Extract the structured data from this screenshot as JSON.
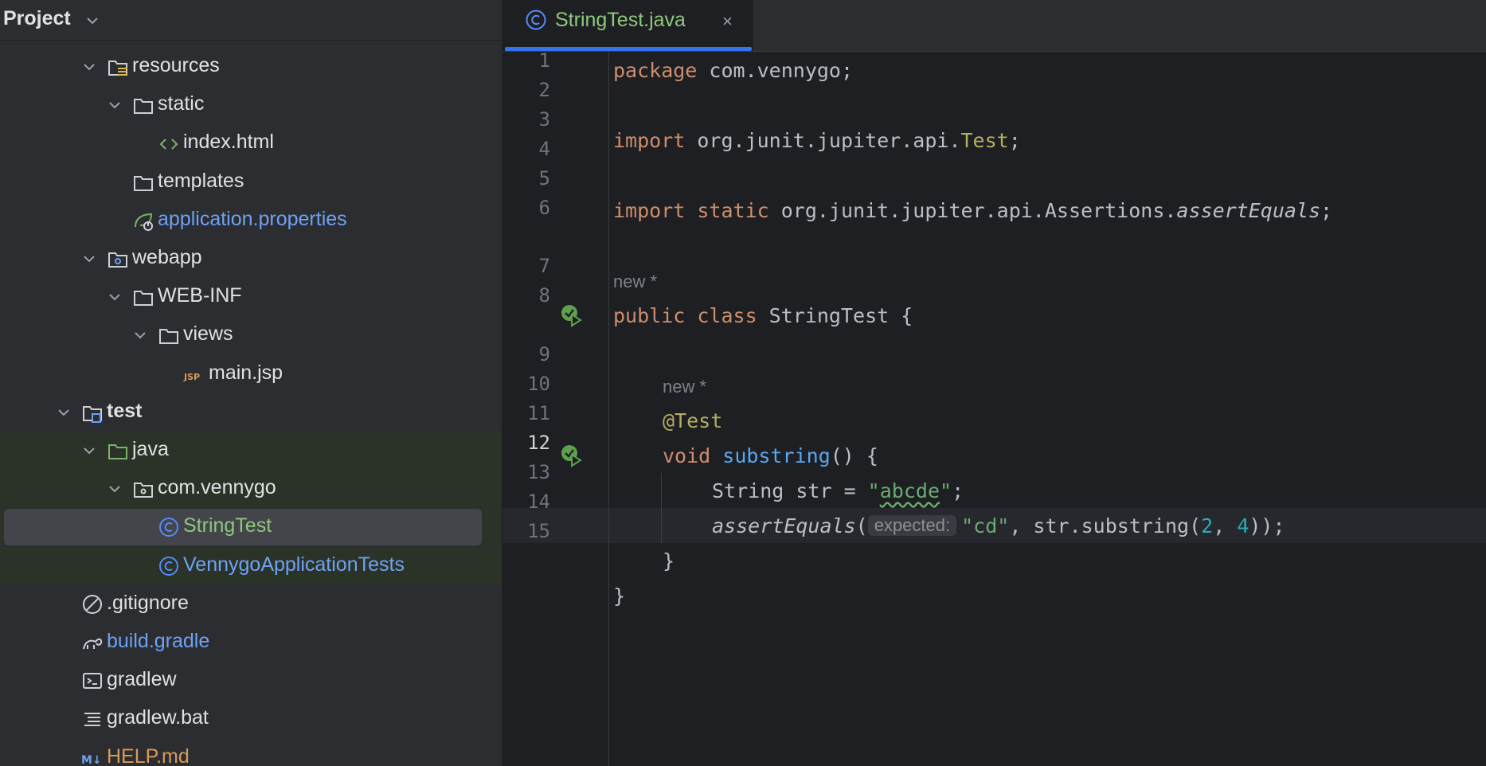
{
  "project": {
    "title": "Project",
    "tree": [
      {
        "label": "resources",
        "icon": "resources-folder-icon",
        "level": 3,
        "expanded": true,
        "color": "default"
      },
      {
        "label": "static",
        "icon": "folder-icon",
        "level": 4,
        "expanded": true,
        "color": "default"
      },
      {
        "label": "index.html",
        "icon": "html-file-icon",
        "level": 5,
        "color": "default"
      },
      {
        "label": "templates",
        "icon": "folder-icon",
        "level": 4,
        "color": "default"
      },
      {
        "label": "application.properties",
        "icon": "spring-properties-icon",
        "level": 4,
        "color": "blue"
      },
      {
        "label": "webapp",
        "icon": "web-folder-icon",
        "level": 3,
        "expanded": true,
        "color": "default"
      },
      {
        "label": "WEB-INF",
        "icon": "folder-icon",
        "level": 4,
        "expanded": true,
        "color": "default"
      },
      {
        "label": "views",
        "icon": "folder-icon",
        "level": 5,
        "expanded": true,
        "color": "default"
      },
      {
        "label": "main.jsp",
        "icon": "jsp-file-icon",
        "level": 6,
        "color": "default"
      },
      {
        "label": "test",
        "icon": "test-module-folder-icon",
        "level": 2,
        "expanded": true,
        "color": "default",
        "bold": true
      },
      {
        "label": "java",
        "icon": "test-source-folder-icon",
        "level": 3,
        "expanded": true,
        "color": "default",
        "green_bg": true
      },
      {
        "label": "com.vennygo",
        "icon": "package-icon",
        "level": 4,
        "expanded": true,
        "color": "default",
        "green_bg": true
      },
      {
        "label": "StringTest",
        "icon": "java-class-icon",
        "level": 5,
        "color": "green",
        "green_bg": true,
        "selected": true
      },
      {
        "label": "VennygoApplicationTests",
        "icon": "java-class-icon",
        "level": 5,
        "color": "blue",
        "green_bg": true
      },
      {
        "label": ".gitignore",
        "icon": "ignore-file-icon",
        "level": 2,
        "color": "default"
      },
      {
        "label": "build.gradle",
        "icon": "gradle-icon",
        "level": 2,
        "color": "blue"
      },
      {
        "label": "gradlew",
        "icon": "terminal-file-icon",
        "level": 2,
        "color": "default"
      },
      {
        "label": "gradlew.bat",
        "icon": "text-file-icon",
        "level": 2,
        "color": "default"
      },
      {
        "label": "HELP.md",
        "icon": "markdown-icon",
        "level": 2,
        "color": "orange"
      }
    ]
  },
  "editor": {
    "tab": {
      "label": "StringTest.java",
      "close": "×"
    },
    "current_line": 12,
    "new_marker": "new *",
    "param_hint": "expected:",
    "lines": [
      {
        "n": "1"
      },
      {
        "n": "2"
      },
      {
        "n": "3"
      },
      {
        "n": "4"
      },
      {
        "n": "5"
      },
      {
        "n": "6"
      },
      {
        "n": "7"
      },
      {
        "n": "8"
      },
      {
        "n": "9"
      },
      {
        "n": "10"
      },
      {
        "n": "11"
      },
      {
        "n": "12"
      },
      {
        "n": "13"
      },
      {
        "n": "14"
      },
      {
        "n": "15"
      }
    ],
    "code": {
      "package_kw": "package",
      "package_name": " com.vennygo;",
      "import_kw": "import",
      "import1_path": " org.junit.jupiter.api.",
      "import1_cls": "Test",
      "semicolon": ";",
      "static_kw": " static",
      "import2_path": " org.junit.jupiter.api.Assertions.",
      "import2_member": "assertEquals",
      "public_kw": "public",
      "class_kw": " class",
      "class_name": " StringTest {",
      "annotation": "@Test",
      "void_kw": "void",
      "method_name": " substring",
      "method_tail": "() {",
      "decl": "String str = ",
      "str_lit": "\"abcde\"",
      "assert_fn": "assertEquals",
      "open_paren": "(",
      "cd_lit": "\"cd\"",
      "call_mid": ", str.substring(",
      "num2": "2",
      "comma": ", ",
      "num4": "4",
      "call_end": "));",
      "close_brace": "}"
    }
  },
  "colors": {
    "accent": "#3574f0",
    "green_text": "#8fc77d",
    "blue_text": "#6ea2f5"
  }
}
